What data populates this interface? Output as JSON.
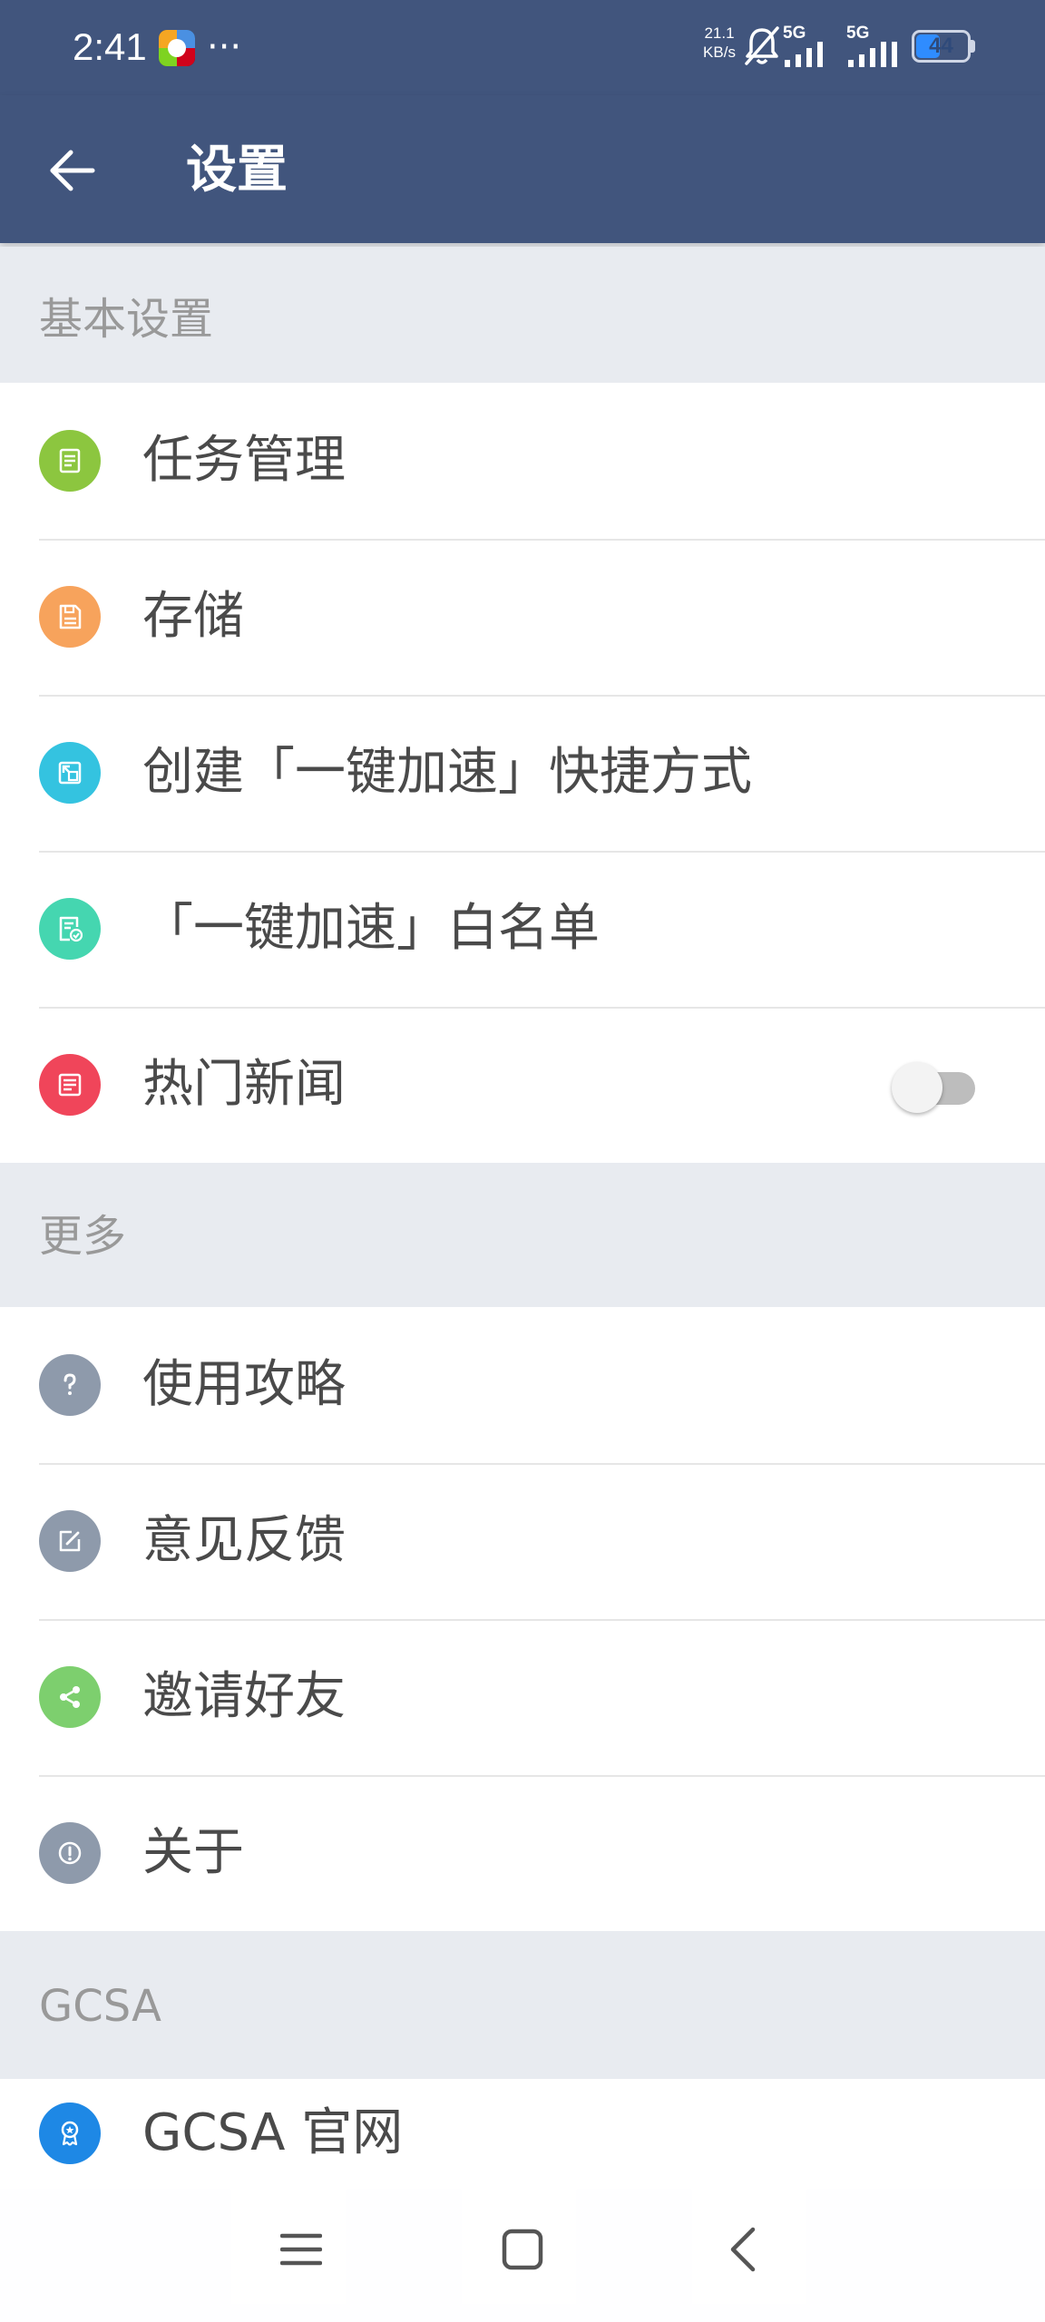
{
  "status_bar": {
    "time": "2:41",
    "more": "···",
    "speed_value": "21.1",
    "speed_unit": "KB/s",
    "signal_1": "5G",
    "signal_2": "5G",
    "battery_level": "44"
  },
  "header": {
    "title": "设置",
    "back_icon": "arrow-left-icon"
  },
  "sections": [
    {
      "title": "基本设置",
      "items": [
        {
          "label": "任务管理",
          "icon": "task-list-icon",
          "color": "#8cc63f"
        },
        {
          "label": "存储",
          "icon": "floppy-disk-icon",
          "color": "#f7a35c"
        },
        {
          "label": "创建「一键加速」快捷方式",
          "icon": "shortcut-icon",
          "color": "#34c3e0"
        },
        {
          "label": "「一键加速」白名单",
          "icon": "whitelist-icon",
          "color": "#45d6b0"
        },
        {
          "label": "热门新闻",
          "icon": "news-icon",
          "color": "#f0455a",
          "toggle": false
        }
      ]
    },
    {
      "title": "更多",
      "items": [
        {
          "label": "使用攻略",
          "icon": "question-icon",
          "color": "#8e9aab"
        },
        {
          "label": "意见反馈",
          "icon": "edit-icon",
          "color": "#8e9aab"
        },
        {
          "label": "邀请好友",
          "icon": "share-icon",
          "color": "#7dcf6e"
        },
        {
          "label": "关于",
          "icon": "info-icon",
          "color": "#8e9aab"
        }
      ]
    },
    {
      "title": "GCSA",
      "items": [
        {
          "label": "GCSA 官网",
          "icon": "award-badge-icon",
          "color": "#1e88e5"
        }
      ]
    }
  ],
  "nav_bar": {
    "menu_icon": "menu-icon",
    "home_icon": "home-square-icon",
    "back_icon": "back-chevron-icon"
  }
}
